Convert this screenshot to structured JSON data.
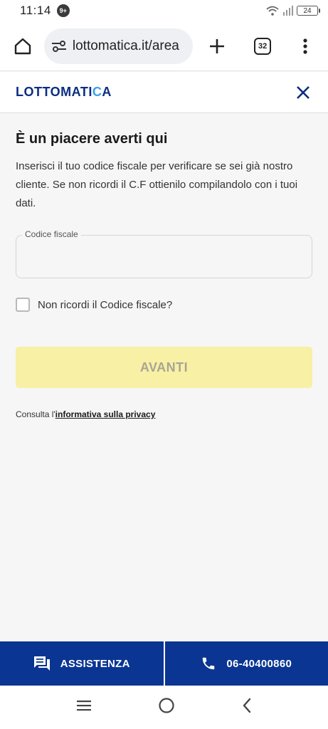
{
  "status_bar": {
    "time": "11:14",
    "notif_badge": "9+",
    "network": "4G",
    "battery": "24"
  },
  "browser": {
    "url": "lottomatica.it/area",
    "tabs_count": "32"
  },
  "site": {
    "logo_part1": "LOTTOMATI",
    "logo_part2": "C",
    "logo_part3": "A"
  },
  "main": {
    "title": "È un piacere averti qui",
    "intro": "Inserisci il tuo codice fiscale per verificare se sei già nostro cliente. Se non ricordi il C.F ottienilo compilandolo con i tuoi dati.",
    "fiscal_code_label": "Codice fiscale",
    "fiscal_code_value": "",
    "checkbox_label": "Non ricordi il Codice fiscale?",
    "submit_label": "AVANTI",
    "privacy_prefix": "Consulta l'",
    "privacy_link": "informativa sulla privacy"
  },
  "footer": {
    "assist_label": "ASSISTENZA",
    "phone_label": "06-40400860"
  },
  "colors": {
    "brand": "#0a3592",
    "button_disabled": "#f8f0a4"
  }
}
